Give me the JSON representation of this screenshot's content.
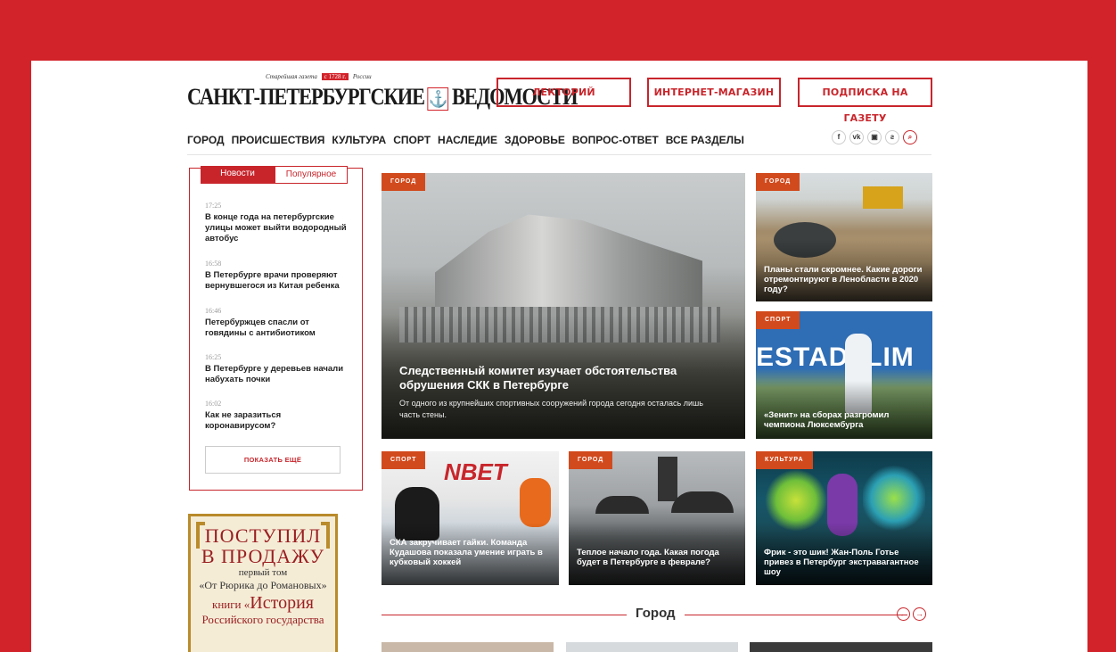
{
  "logo": {
    "tagline_left": "Старейшая газета",
    "since": "с 1728 г.",
    "tagline_right": "России",
    "name_left": "САНКТ-ПЕТЕРБУРГСКИЕ",
    "name_right": "ВЕДОМОСТИ"
  },
  "top_buttons": [
    "ЛЕКТОРИЙ",
    "ИНТЕРНЕТ-МАГАЗИН",
    "ПОДПИСКА НА ГАЗЕТУ"
  ],
  "nav": [
    "ГОРОД",
    "ПРОИСШЕСТВИЯ",
    "КУЛЬТУРА",
    "СПОРТ",
    "НАСЛЕДИЕ",
    "ЗДОРОВЬЕ",
    "ВОПРОС-ОТВЕТ",
    "ВСЕ РАЗДЕЛЫ"
  ],
  "social": [
    "f",
    "vk",
    "instagram",
    "z"
  ],
  "sidebar": {
    "tab_news": "Новости",
    "tab_popular": "Популярное",
    "items": [
      {
        "time": "17:25",
        "title": "В конце года на петербургские улицы может выйти водородный автобус"
      },
      {
        "time": "16:58",
        "title": "В Петербурге врачи проверяют вернувшегося из Китая ребенка"
      },
      {
        "time": "16:46",
        "title": "Петербуржцев спасли от говядины с антибиотиком"
      },
      {
        "time": "16:25",
        "title": "В Петербурге у деревьев начали набухать почки"
      },
      {
        "time": "16:02",
        "title": "Как не заразиться коронавирусом?"
      }
    ],
    "more": "ПОКАЗАТЬ ЕЩЁ"
  },
  "ad": {
    "line1": "ПОСТУПИЛ",
    "line2": "В ПРОДАЖУ",
    "line3": "первый том",
    "line4": "«От Рюрика до Романовых»",
    "line5a": "книги «",
    "line5b": "История",
    "line6": "Российского государства"
  },
  "cards": {
    "big": {
      "cat": "ГОРОД",
      "title": "Следственный комитет изучает обстоятельства обрушения СКК в Петербурге",
      "sub": "От одного из крупнейших спортивных сооружений города сегодня осталась лишь часть стены."
    },
    "right1": {
      "cat": "ГОРОД",
      "title": "Планы стали скромнее. Какие дороги отремонтируют в Ленобласти в 2020 году?"
    },
    "right2": {
      "cat": "СПОРТ",
      "title": "«Зенит» на сборах разгромил чемпиона Люксембурга"
    },
    "row1": {
      "cat": "СПОРТ",
      "title": "СКА закручивает гайки. Команда Кудашова показала умение играть в кубковый хоккей"
    },
    "row2": {
      "cat": "ГОРОД",
      "title": "Теплое начало года. Какая погода будет в Петербурге в феврале?"
    },
    "row3": {
      "cat": "КУЛЬТУРА",
      "title": "Фрик - это шик! Жан-Поль Готье привез в Петербург экстравагантное шоу"
    }
  },
  "section": {
    "title": "Город"
  },
  "colors": {
    "brand": "#d2232a",
    "category": "#d14a1d"
  }
}
